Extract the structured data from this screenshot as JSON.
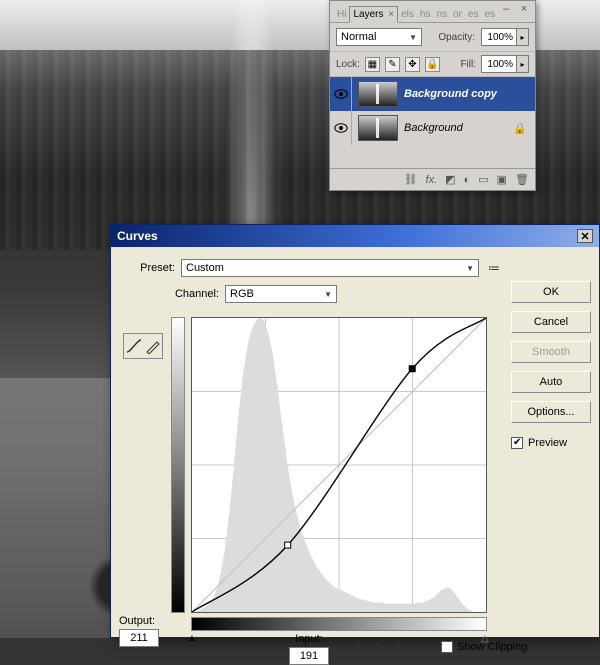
{
  "layers_panel": {
    "tabs": [
      "Hi",
      "Layers",
      "els",
      "hs",
      "ns",
      "or",
      "es",
      "es"
    ],
    "active_tab": "Layers",
    "blend_mode": "Normal",
    "opacity_label": "Opacity:",
    "opacity_value": "100%",
    "lock_label": "Lock:",
    "fill_label": "Fill:",
    "fill_value": "100%",
    "layers": [
      {
        "name": "Background copy",
        "visible": true,
        "selected": true,
        "locked": false
      },
      {
        "name": "Background",
        "visible": true,
        "selected": false,
        "locked": true
      }
    ],
    "footer_icons": [
      "link",
      "fx",
      "mask",
      "adjust",
      "group",
      "new",
      "trash"
    ]
  },
  "curves_dialog": {
    "title": "Curves",
    "preset_label": "Preset:",
    "preset_value": "Custom",
    "channel_label": "Channel:",
    "channel_value": "RGB",
    "output_label": "Output:",
    "output_value": "211",
    "input_label": "Input:",
    "input_value": "191",
    "show_clipping_label": "Show Clipping",
    "show_clipping_checked": false,
    "buttons": {
      "ok": "OK",
      "cancel": "Cancel",
      "smooth": "Smooth",
      "auto": "Auto",
      "options": "Options..."
    },
    "preview_label": "Preview",
    "preview_checked": true
  },
  "chart_data": {
    "type": "line",
    "title": "Curves",
    "xlabel": "Input",
    "ylabel": "Output",
    "xlim": [
      0,
      255
    ],
    "ylim": [
      0,
      255
    ],
    "control_points": [
      {
        "input": 0,
        "output": 0
      },
      {
        "input": 83,
        "output": 58
      },
      {
        "input": 191,
        "output": 211
      },
      {
        "input": 255,
        "output": 255
      }
    ],
    "active_point": {
      "input": 191,
      "output": 211
    },
    "histogram_bins": [
      0,
      0,
      1,
      2,
      3,
      5,
      7,
      10,
      15,
      22,
      32,
      45,
      62,
      82,
      104,
      128,
      150,
      170,
      185,
      197,
      205,
      210,
      213,
      214,
      213,
      208,
      200,
      190,
      176,
      160,
      142,
      126,
      110,
      96,
      84,
      74,
      65,
      58,
      52,
      46,
      41,
      37,
      33,
      30,
      27,
      24,
      22,
      20,
      18,
      17,
      16,
      15,
      14,
      13,
      12,
      11,
      10,
      9,
      9,
      8,
      8,
      7,
      7,
      7,
      7,
      6,
      6,
      6,
      6,
      6,
      6,
      6,
      6,
      6,
      6,
      6,
      7,
      7,
      7,
      8,
      9,
      10,
      12,
      14,
      16,
      17,
      18,
      17,
      15,
      12,
      9,
      6,
      4,
      2,
      1,
      0,
      0,
      0,
      0,
      0
    ],
    "histogram_max": 214
  }
}
